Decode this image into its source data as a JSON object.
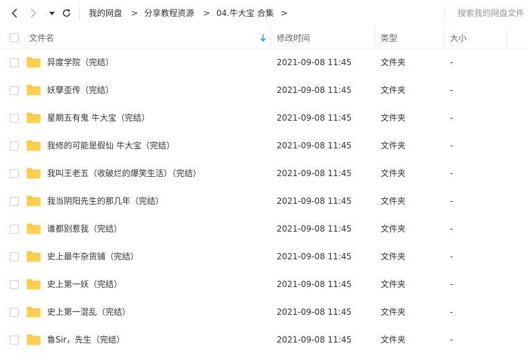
{
  "toolbar": {
    "breadcrumbs": [
      "我的网盘",
      "分享教程资源",
      "04.牛大宝 合集"
    ],
    "separator": ">",
    "search_placeholder": "搜索我的网盘文件"
  },
  "table": {
    "columns": {
      "name": "文件名",
      "modified": "修改时间",
      "type": "类型",
      "size": "大小"
    },
    "sort_icon": "arrow-down-icon",
    "folder_icon": "folder-icon",
    "folder_color": "#ffc53d",
    "sort_color": "#1e90ff",
    "rows": [
      {
        "name": "异度学院（完结）",
        "modified": "2021-09-08 11:45",
        "type": "文件夹",
        "size": "-"
      },
      {
        "name": "妖孽歪传（完结）",
        "modified": "2021-09-08 11:45",
        "type": "文件夹",
        "size": "-"
      },
      {
        "name": "星期五有鬼 牛大宝（完结）",
        "modified": "2021-09-08 11:45",
        "type": "文件夹",
        "size": "-"
      },
      {
        "name": "我修的可能是假仙 牛大宝（完结）",
        "modified": "2021-09-08 11:45",
        "type": "文件夹",
        "size": "-"
      },
      {
        "name": "我叫王老五（收破烂的爆笑生活）（完结）",
        "modified": "2021-09-08 11:45",
        "type": "文件夹",
        "size": "-"
      },
      {
        "name": "我当阴阳先生的那几年（完结）",
        "modified": "2021-09-08 11:45",
        "type": "文件夹",
        "size": "-"
      },
      {
        "name": "谁都别惹我（完结）",
        "modified": "2021-09-08 11:45",
        "type": "文件夹",
        "size": "-"
      },
      {
        "name": "史上最牛杂货铺（完结）",
        "modified": "2021-09-08 11:45",
        "type": "文件夹",
        "size": "-"
      },
      {
        "name": "史上第一妖（完结）",
        "modified": "2021-09-08 11:45",
        "type": "文件夹",
        "size": "-"
      },
      {
        "name": "史上第一混乱（完结）",
        "modified": "2021-09-08 11:45",
        "type": "文件夹",
        "size": "-"
      },
      {
        "name": "鲁Sir，先生（完结）",
        "modified": "2021-09-08 11:45",
        "type": "文件夹",
        "size": "-"
      }
    ]
  }
}
